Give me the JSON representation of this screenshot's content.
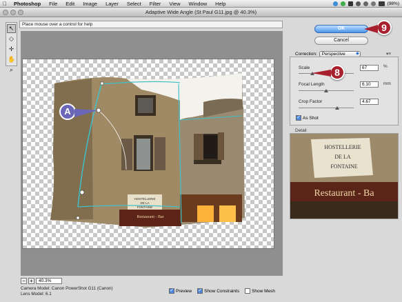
{
  "menubar": {
    "apple": "",
    "app_name": "Photoshop",
    "items": [
      "File",
      "Edit",
      "Image",
      "Layer",
      "Select",
      "Filter",
      "View",
      "Window",
      "Help"
    ],
    "battery": "(98%)"
  },
  "window": {
    "title": "Adaptive Wide Angle (St Paul G11.jpg @ 40.3%)"
  },
  "hint": "Place mouse over a control for help",
  "zoom": {
    "minus": "−",
    "plus": "+",
    "value": "40.3%"
  },
  "camera": {
    "model": "Camera Model: Canon PowerShot G11 (Canon)",
    "lens": "Lens Model: 6.1"
  },
  "options": {
    "preview": "Preview",
    "show_constraints": "Show Constraints",
    "show_mesh": "Show Mesh"
  },
  "buttons": {
    "ok": "OK",
    "cancel": "Cancel"
  },
  "correction": {
    "label": "Correction:",
    "selected": "Perspective",
    "scale": {
      "label": "Scale",
      "value": "67",
      "unit": "%",
      "level": 0.25
    },
    "focal": {
      "label": "Focal Length",
      "value": "6.10",
      "unit": "mm",
      "level": 0.5
    },
    "crop": {
      "label": "Crop Factor",
      "value": "4.67",
      "level": 0.7
    },
    "as_shot": "As Shot"
  },
  "detail": {
    "label": "Detail",
    "sign_lines": [
      "HOSTELLERIE",
      "DE LA",
      "FONTAINE"
    ],
    "banner": "Restaurant - Ba"
  },
  "image_sign": {
    "lines": [
      "HOSTELLERIE",
      "DE LA",
      "FONTAINE"
    ],
    "banner": "Restaurant - Bar"
  },
  "callouts": {
    "a": "A",
    "eight": "8",
    "nine": "9"
  },
  "colors": {
    "accent": "#4c95ea",
    "callout_red": "#a8202d",
    "callout_purple": "#6b67b8",
    "constraint": "#3fc0c8"
  }
}
